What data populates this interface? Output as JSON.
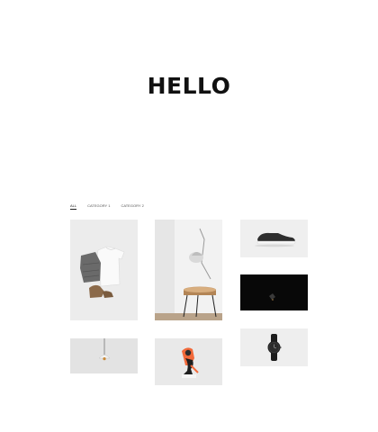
{
  "hero": {
    "title": "HELLO"
  },
  "filters": [
    {
      "label": "ALL",
      "active": true
    },
    {
      "label": "CATEGORY 1",
      "active": false
    },
    {
      "label": "CATEGORY 2",
      "active": false
    }
  ],
  "portfolio": [
    {
      "icon": "clothes-flatlay-photo"
    },
    {
      "icon": "desk-lamp-table-photo"
    },
    {
      "icon": "sneaker-photo"
    },
    {
      "icon": "dark-pendant-lamp-photo"
    },
    {
      "icon": "wristwatch-photo"
    },
    {
      "icon": "pendant-lamp-photo"
    },
    {
      "icon": "dancer-illustration-photo"
    }
  ]
}
